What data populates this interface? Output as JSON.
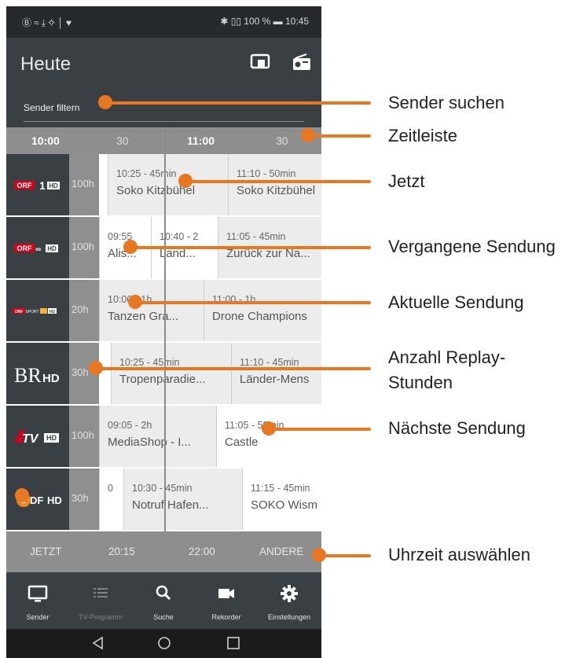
{
  "status_bar": {
    "left_icons": "Ⓑ≈⤓✧│♥",
    "right_text": "✱ ▯▯ 100 % ▬ 10:45"
  },
  "app_bar": {
    "title": "Heute",
    "icons": [
      "cast-icon",
      "radio-icon"
    ]
  },
  "filter": {
    "label": "Sender filtern"
  },
  "timeline": {
    "labels": [
      "10:00",
      "30",
      "11:00",
      "30"
    ]
  },
  "channels": [
    {
      "logo": "ORF 1 HD",
      "hours": "100h",
      "programs": [
        {
          "time": "10:25 - 45min",
          "name": "Soko Kitzbühel"
        },
        {
          "time": "11:10 - 50min",
          "name": "Soko Kitzbühel"
        }
      ]
    },
    {
      "logo": "ORF III HD",
      "hours": "100h",
      "programs": [
        {
          "time": "09:55",
          "name": "Alis..."
        },
        {
          "time": "10:40 - 2",
          "name": "Land..."
        },
        {
          "time": "11:05 - 45min",
          "name": "Zurück zur Na..."
        }
      ]
    },
    {
      "logo": "ORF SPORT+ HD",
      "hours": "20h",
      "programs": [
        {
          "time": "10:00 - 1h",
          "name": "Tanzen Gra..."
        },
        {
          "time": "11:00 - 1h",
          "name": "Drone Champions"
        }
      ]
    },
    {
      "logo": "BR HD",
      "hours": "30h",
      "programs": [
        {
          "time": "10:25 - 45min",
          "name": "Tropenparadie..."
        },
        {
          "time": "11:10 - 45min",
          "name": "Länder-Mens"
        }
      ]
    },
    {
      "logo": "ATV HD",
      "hours": "100h",
      "programs": [
        {
          "time": "09:05 - 2h",
          "name": "MediaShop - I..."
        },
        {
          "time": "11:05 - 50min",
          "name": "Castle"
        }
      ]
    },
    {
      "logo": "ZDF HD",
      "hours": "30h",
      "programs": [
        {
          "time": "0",
          "name": ""
        },
        {
          "time": "10:30 - 45min",
          "name": "Notruf Hafen..."
        },
        {
          "time": "11:15 - 45min",
          "name": "SOKO Wism"
        }
      ]
    }
  ],
  "quick_times": [
    "JETZT",
    "20:15",
    "22:00",
    "ANDERE"
  ],
  "bottom_nav": [
    {
      "label": "Sender",
      "icon": "tv-icon"
    },
    {
      "label": "TV-Programm",
      "icon": "list-icon"
    },
    {
      "label": "Suche",
      "icon": "search-icon"
    },
    {
      "label": "Rekorder",
      "icon": "camera-icon"
    },
    {
      "label": "Einstellungen",
      "icon": "gear-icon"
    }
  ],
  "annotations": [
    "Sender suchen",
    "Zeitleiste",
    "Jetzt",
    "Vergangene Sendung",
    "Aktuelle Sendung",
    "Anzahl Replay-",
    "Stunden",
    "Nächste Sendung",
    "Uhrzeit auswählen"
  ],
  "accent_color": "#e87722"
}
